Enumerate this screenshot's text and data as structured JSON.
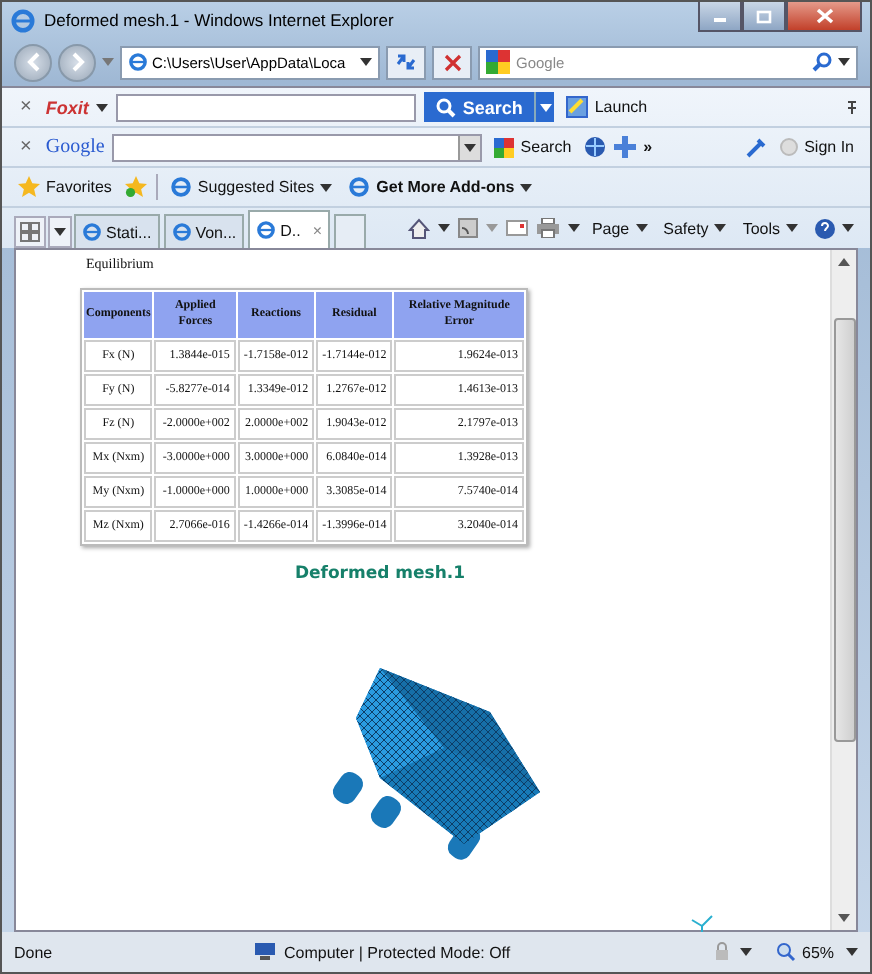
{
  "window": {
    "title": "Deformed mesh.1 - Windows Internet Explorer"
  },
  "address_bar": {
    "value": "C:\\Users\\User\\AppData\\Loca"
  },
  "search_box": {
    "placeholder": "Google"
  },
  "foxit_toolbar": {
    "close": "×",
    "logo": "Foxit",
    "search_button": "Search",
    "launch_button": "Launch"
  },
  "google_toolbar": {
    "close": "×",
    "logo": "Google",
    "search_button": "Search",
    "more": "»",
    "sign_in": "Sign In"
  },
  "favorites_bar": {
    "items": [
      {
        "label": "Favorites",
        "kind": "star"
      },
      {
        "label": "Suggested Sites",
        "kind": "ie"
      },
      {
        "label": "Get More Add-ons",
        "kind": "ie"
      }
    ]
  },
  "tabs": [
    {
      "label": "Stati...",
      "selected": false
    },
    {
      "label": "Von...",
      "selected": false
    },
    {
      "label": "D..",
      "selected": true,
      "close": "×"
    }
  ],
  "command_bar": [
    "Page",
    "Safety",
    "Tools"
  ],
  "page": {
    "section": "Equilibrium",
    "table": {
      "columns": [
        "Components",
        "Applied Forces",
        "Reactions",
        "Residual",
        "Relative Magnitude Error"
      ],
      "rows": [
        [
          "Fx (N)",
          "1.3844e-015",
          "-1.7158e-012",
          "-1.7144e-012",
          "1.9624e-013"
        ],
        [
          "Fy (N)",
          "-5.8277e-014",
          "1.3349e-012",
          "1.2767e-012",
          "1.4613e-013"
        ],
        [
          "Fz (N)",
          "-2.0000e+002",
          "2.0000e+002",
          "1.9043e-012",
          "2.1797e-013"
        ],
        [
          "Mx (Nxm)",
          "-3.0000e+000",
          "3.0000e+000",
          "6.0840e-014",
          "1.3928e-013"
        ],
        [
          "My (Nxm)",
          "-1.0000e+000",
          "1.0000e+000",
          "3.3085e-014",
          "7.5740e-014"
        ],
        [
          "Mz (Nxm)",
          "2.7066e-016",
          "-1.4266e-014",
          "-1.3996e-014",
          "3.2040e-014"
        ]
      ]
    },
    "image_title": "Deformed mesh.1"
  },
  "status_bar": {
    "text": "Done",
    "zone": "Computer | Protected Mode: Off",
    "zoom": "65%"
  }
}
